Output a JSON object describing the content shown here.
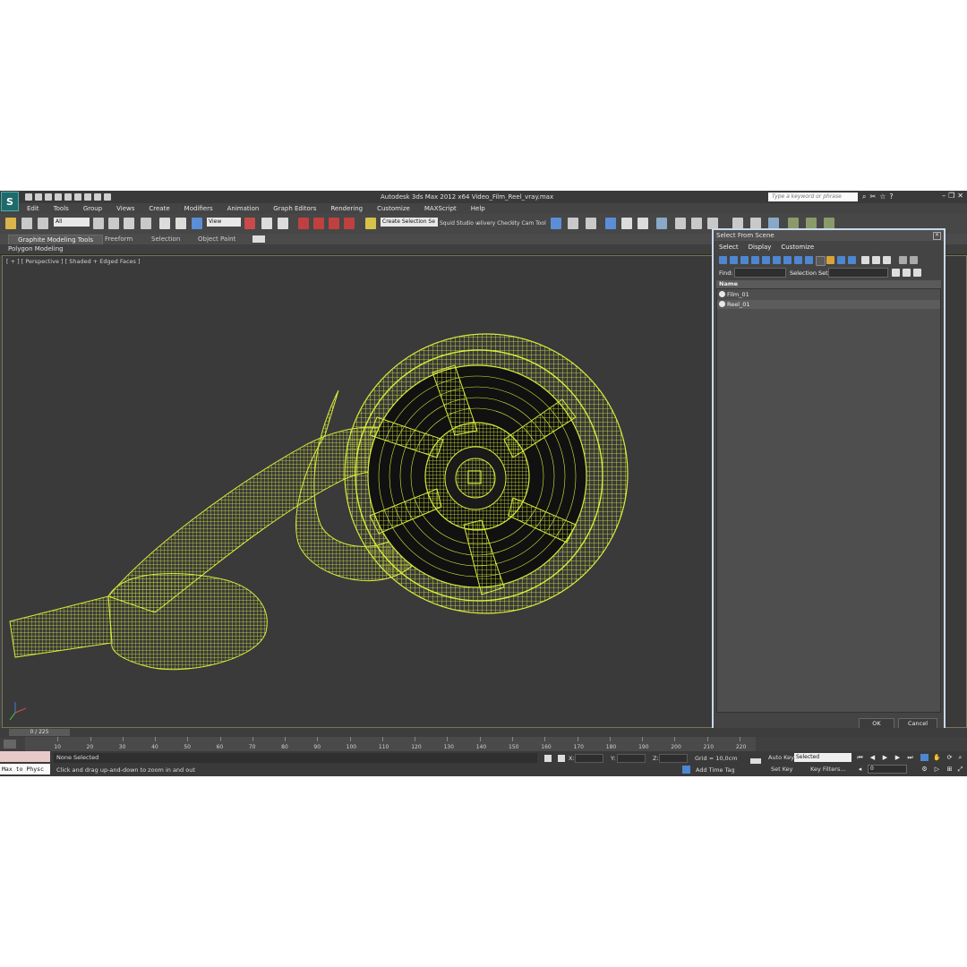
{
  "app": {
    "logo_text": "S",
    "title": "Autodesk 3ds Max  2012 x64       Video_Film_Reel_vray.max",
    "search_placeholder": "Type a keyword or phrase"
  },
  "menu": [
    "Edit",
    "Tools",
    "Group",
    "Views",
    "Create",
    "Modifiers",
    "Animation",
    "Graph Editors",
    "Rendering",
    "Customize",
    "MAXScript",
    "Help"
  ],
  "toolbar": {
    "filter_value": "All",
    "refcoord_value": "View",
    "selection_set_value": "Create Selection Se",
    "squid_text": "Squid Studio v",
    "delivery_text": "elivery Check",
    "citycam_text": "ity Cam Tool"
  },
  "ribbon": {
    "tabs": [
      "Graphite Modeling Tools",
      "Freeform",
      "Selection",
      "Object Paint"
    ],
    "active_tab": "Graphite Modeling Tools",
    "subpanel": "Polygon Modeling"
  },
  "viewport": {
    "labels": "[ + ] [ Perspective ] [ Shaded + Edged Faces ]"
  },
  "timeline": {
    "slider_text": "0 / 225",
    "ticks": [
      "10",
      "20",
      "30",
      "40",
      "50",
      "60",
      "70",
      "80",
      "90",
      "100",
      "110",
      "120",
      "130",
      "140",
      "150",
      "160",
      "170",
      "180",
      "190",
      "200",
      "210",
      "220"
    ]
  },
  "status": {
    "maxscript_text": "Max to Physc",
    "selection": "None Selected",
    "prompt": "Click and drag up-and-down to zoom in and out",
    "x_label": "X:",
    "y_label": "Y:",
    "z_label": "Z:",
    "grid": "Grid = 10,0cm",
    "add_time_tag": "Add Time Tag",
    "auto_key": "Auto Key",
    "set_key": "Set Key",
    "key_mode_value": "Selected",
    "key_filters": "Key Filters...",
    "frame_value": "0"
  },
  "dialog": {
    "title": "Select From Scene",
    "menu": [
      "Select",
      "Display",
      "Customize"
    ],
    "find_label": "Find:",
    "selection_set_label": "Selection Set:",
    "column_name": "Name",
    "rows": [
      "Film_01",
      "Reel_01"
    ],
    "ok": "OK",
    "cancel": "Cancel"
  },
  "colors": {
    "wireframe": "#d8ec3a",
    "viewport_bg": "#3a3a3a",
    "dialog_border": "#c9d9ec"
  }
}
